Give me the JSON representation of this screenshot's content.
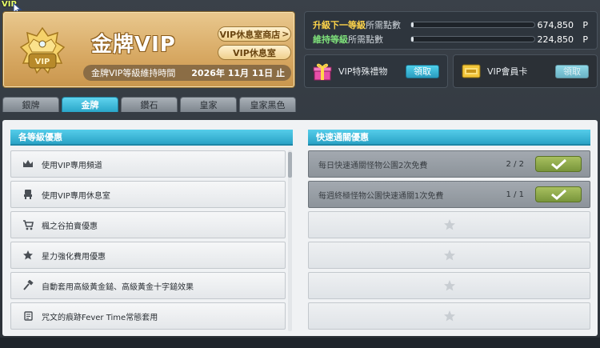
{
  "title": "VIP",
  "header": {
    "tier_title": "金牌VIP",
    "shop_button": "VIP休息室商店",
    "shop_arrow": ">",
    "lounge_button": "VIP休息室",
    "maintain_label": "金牌VIP等級維持時間",
    "maintain_date": "2026年 11月 11日 止",
    "medal_text": "VIP"
  },
  "points": {
    "upgrade_label_highlight": "升級下一等級",
    "upgrade_label_rest": "所需點數",
    "upgrade_value": "674,850",
    "maintain_label_highlight": "維持等級",
    "maintain_label_rest": "所需點數",
    "maintain_value": "224,850",
    "unit": "P",
    "upgrade_progress": 0.02,
    "maintain_progress": 0.02
  },
  "rewards": {
    "gift_label": "VIP特殊禮物",
    "gift_claim": "領取",
    "card_label": "VIP會員卡",
    "card_claim": "領取"
  },
  "tabs": [
    {
      "label": "銀牌"
    },
    {
      "label": "金牌"
    },
    {
      "label": "鑽石"
    },
    {
      "label": "皇家"
    },
    {
      "label": "皇家黑色"
    }
  ],
  "active_tab": "金牌",
  "left_column": {
    "header": "各等級優惠",
    "items": [
      {
        "label": "使用VIP專用頻道",
        "icon": "crown-icon"
      },
      {
        "label": "使用VIP專用休息室",
        "icon": "chair-icon"
      },
      {
        "label": "楓之谷拍賣優惠",
        "icon": "cart-icon"
      },
      {
        "label": "星力強化費用優惠",
        "icon": "star-icon"
      },
      {
        "label": "自動套用高級黃金鎚、高級黃金十字鎚效果",
        "icon": "hammer-icon"
      },
      {
        "label": "咒文的痕跡Fever Time常態套用",
        "icon": "scroll-icon"
      }
    ]
  },
  "right_column": {
    "header": "快速通關優惠",
    "items": [
      {
        "label": "每日快速通關怪物公園2次免費",
        "count": "2 / 2",
        "state": "claimed"
      },
      {
        "label": "每週終極怪物公園快速通關1次免費",
        "count": "1 / 1",
        "state": "claimed"
      },
      {
        "label": "",
        "count": "",
        "state": "locked"
      },
      {
        "label": "",
        "count": "",
        "state": "locked"
      },
      {
        "label": "",
        "count": "",
        "state": "locked"
      },
      {
        "label": "",
        "count": "",
        "state": "locked"
      }
    ]
  },
  "colors": {
    "accent": "#2aa3c6",
    "gold": "#d7a862",
    "highlight_yellow": "#ffd54a",
    "highlight_green": "#7ee07a"
  }
}
